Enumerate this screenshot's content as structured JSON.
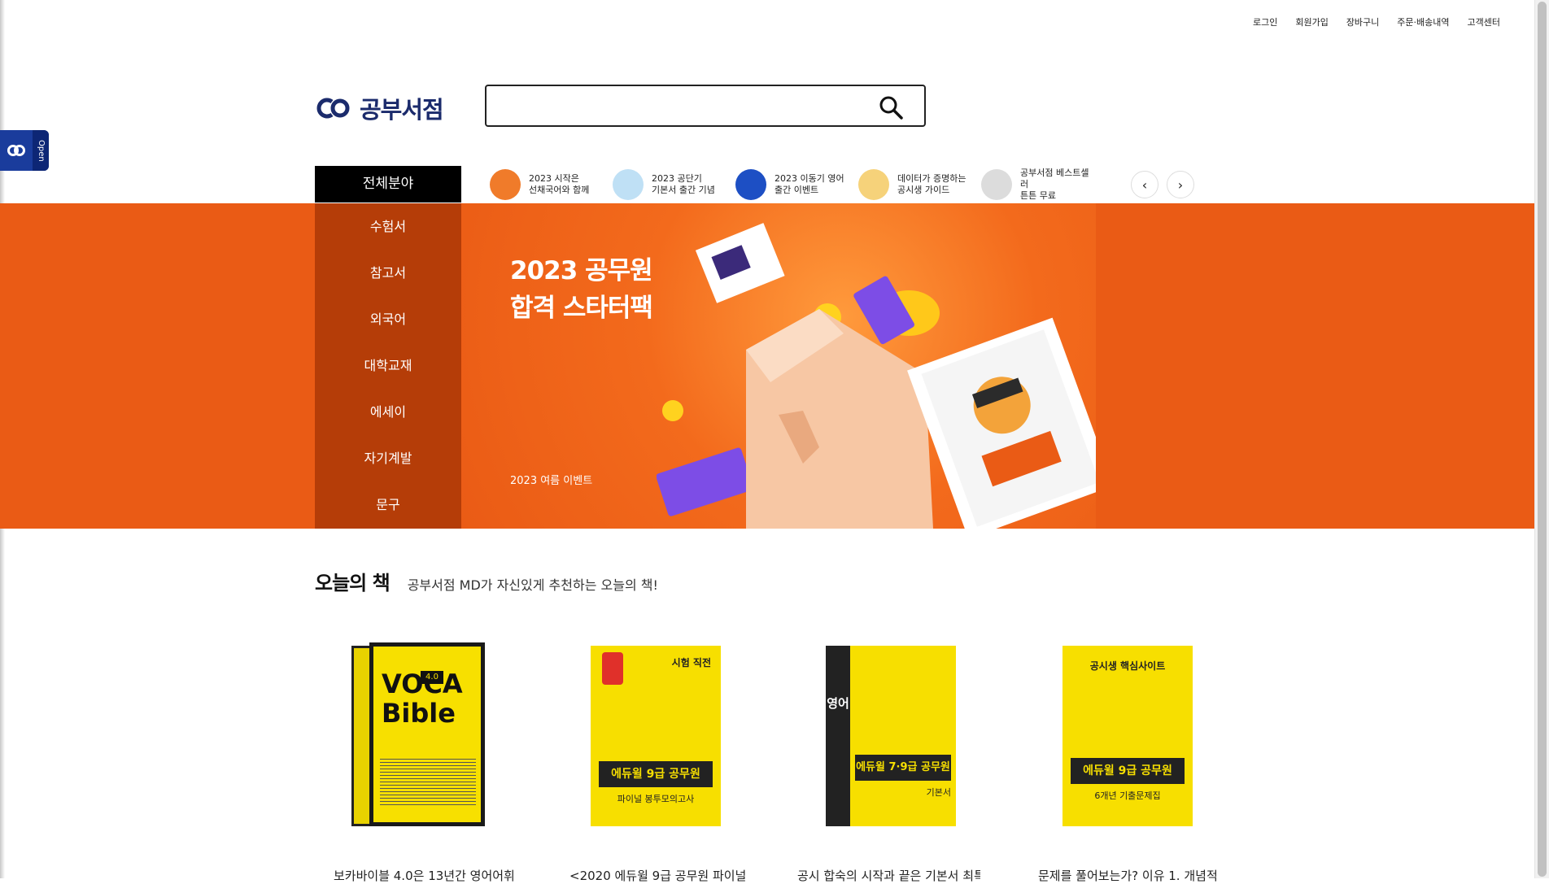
{
  "topnav": {
    "items": [
      "로그인",
      "회원가입",
      "장바구니",
      "주문·배송내역",
      "고객센터"
    ]
  },
  "side_tab": {
    "open_label": "Open"
  },
  "logo": {
    "text": "공부서점",
    "brand_color": "#1b2b6c"
  },
  "search": {
    "value": "",
    "placeholder": ""
  },
  "category": {
    "header": "전체분야",
    "items": [
      "수험서",
      "참고서",
      "외국어",
      "대학교재",
      "에세이",
      "자기계발",
      "문구"
    ]
  },
  "promos": [
    {
      "line1": "2023 시작은",
      "line2": "선채국어와 함께",
      "icon": "fox-icon",
      "color": "#f07b2a"
    },
    {
      "line1": "2023 공단기",
      "line2": "기본서 출간 기념",
      "icon": "gift-icon",
      "color": "#bfe0f5"
    },
    {
      "line1": "2023 이동기 영어",
      "line2": "출간 이벤트",
      "icon": "books-icon",
      "color": "#1d4fc4"
    },
    {
      "line1": "데이터가 증명하는",
      "line2": "공시생 가이드",
      "icon": "folder-icon",
      "color": "#f6d27a"
    },
    {
      "line1": "공부서점 베스트셀러",
      "line2": "튼튼 무료",
      "icon": "percent-icon",
      "color": "#dcdcdc"
    }
  ],
  "banner": {
    "title_line1": "2023 공무원",
    "title_line2": "합격 스타터팩",
    "subtitle": "2023 여름 이벤트",
    "bg_color": "#ea5b15"
  },
  "today": {
    "title": "오늘의 책",
    "subtitle": "공부서점 MD가 자신있게 추천하는 오늘의 책!"
  },
  "books": [
    {
      "title": "보카바이블 4.0은 13년간 영어어휘",
      "cover_text1": "VOCA",
      "cover_text2": "Bible",
      "cover_tag": "4.0"
    },
    {
      "title": "<2020 에듀윌 9급 공무원 파이널",
      "cover_text1": "에듀윌 9급 공무원",
      "cover_text2": "파이널 봉투모의고사",
      "cover_tag": "시험 직전"
    },
    {
      "title": "공시 합숙의 시작과 끝은 기본서 최특",
      "cover_text1": "에듀윌 7·9급 공무원",
      "cover_text2": "기본서",
      "cover_tag": "영어"
    },
    {
      "title": "문제를 풀어보는가? 이유 1. 개념적",
      "cover_text1": "에듀윌 9급 공무원",
      "cover_text2": "6개년 기출문제집",
      "cover_tag": "공시생 핵심사이트"
    }
  ]
}
